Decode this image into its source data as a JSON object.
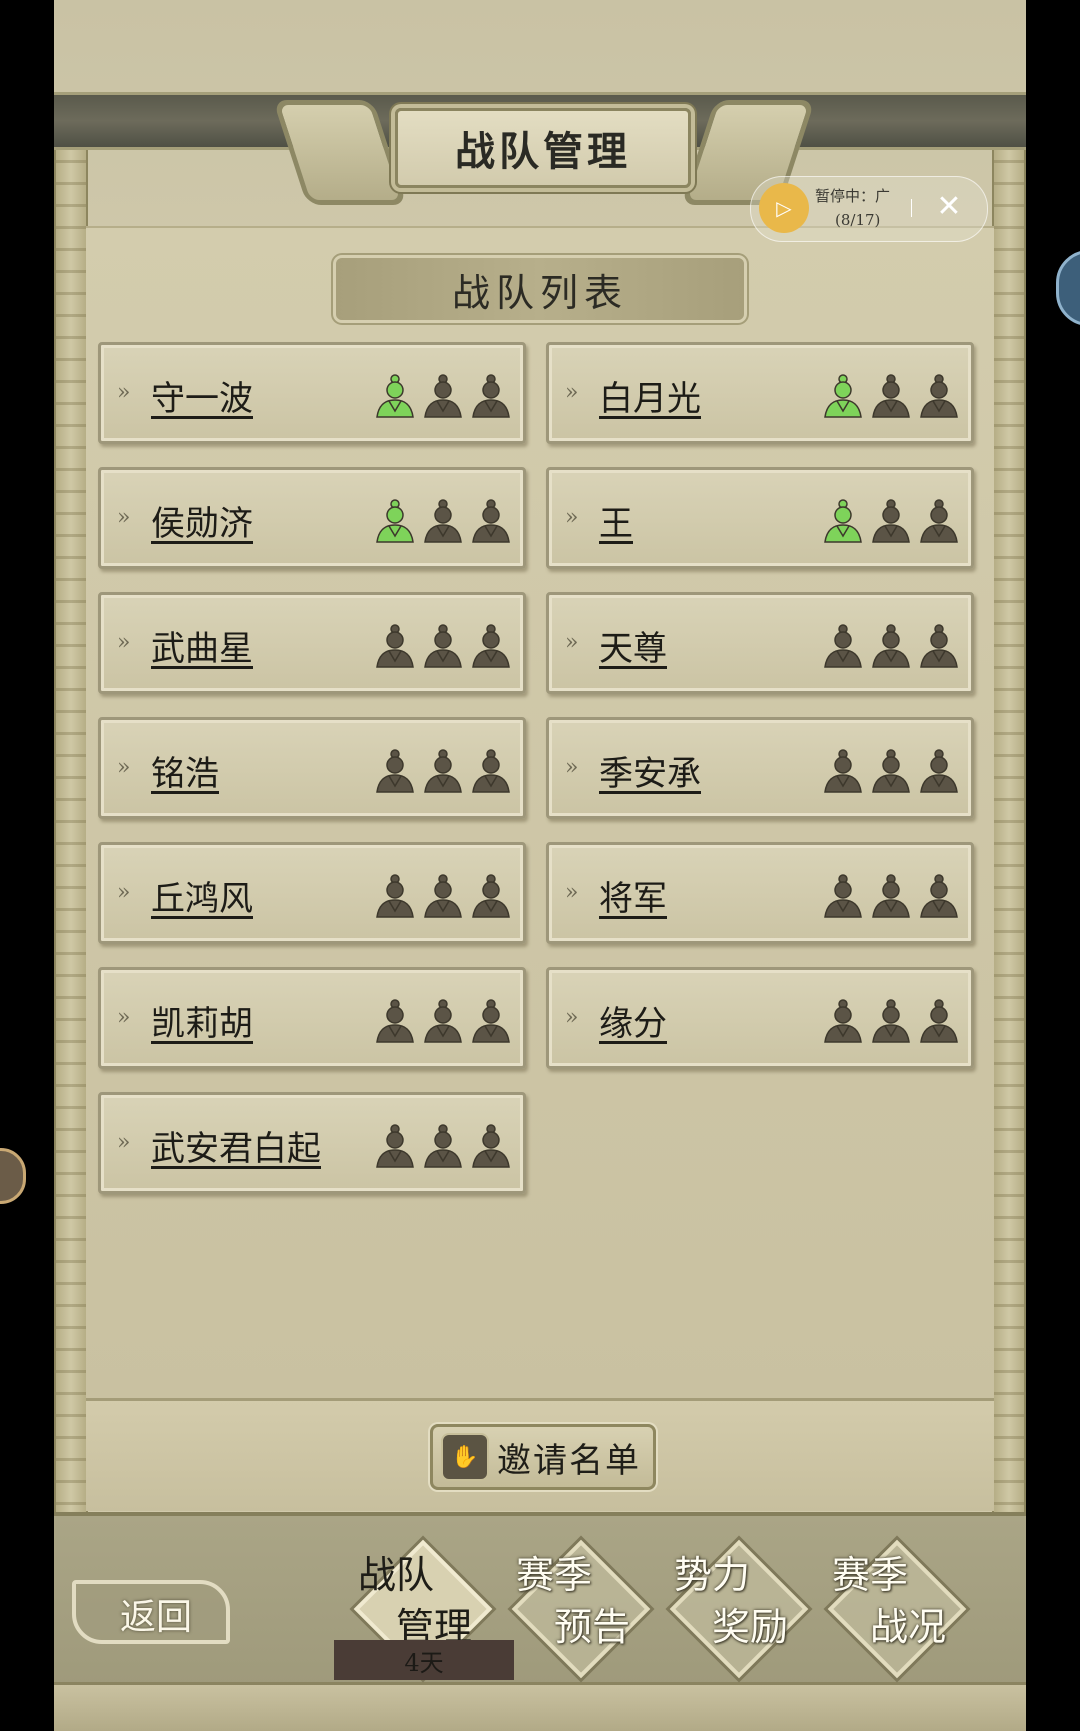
{
  "header": {
    "title": "战队管理"
  },
  "team_list": {
    "title": "战队列表",
    "teams": [
      {
        "name": "守一波",
        "members_filled": 1,
        "slots": 3
      },
      {
        "name": "白月光",
        "members_filled": 1,
        "slots": 3
      },
      {
        "name": "侯勋济",
        "members_filled": 1,
        "slots": 3
      },
      {
        "name": "王",
        "members_filled": 1,
        "slots": 3
      },
      {
        "name": "武曲星",
        "members_filled": 0,
        "slots": 3
      },
      {
        "name": "天尊",
        "members_filled": 0,
        "slots": 3
      },
      {
        "name": "铭浩",
        "members_filled": 0,
        "slots": 3
      },
      {
        "name": "季安承",
        "members_filled": 0,
        "slots": 3
      },
      {
        "name": "丘鸿风",
        "members_filled": 0,
        "slots": 3
      },
      {
        "name": "将军",
        "members_filled": 0,
        "slots": 3
      },
      {
        "name": "凯莉胡",
        "members_filled": 0,
        "slots": 3
      },
      {
        "name": "缘分",
        "members_filled": 0,
        "slots": 3
      },
      {
        "name": "武安君白起",
        "members_filled": 0,
        "slots": 3
      }
    ]
  },
  "invite": {
    "label": "邀请名单",
    "icon": "handshake-icon"
  },
  "bottom_nav": {
    "back_label": "返回",
    "tabs": [
      {
        "line1": "战队",
        "line2": "管理",
        "active": true
      },
      {
        "line1": "赛季",
        "line2": "预告",
        "active": false
      },
      {
        "line1": "势力",
        "line2": "奖励",
        "active": false
      },
      {
        "line1": "赛季",
        "line2": "战况",
        "active": false
      }
    ],
    "timer": "4天"
  },
  "overlay": {
    "status": "暂停中：广",
    "count": "(8/17)",
    "play_icon": "play-icon",
    "close_icon": "close-icon"
  },
  "colors": {
    "member_filled": "#7ed35a",
    "member_empty": "#5b5446",
    "parchment": "#d8d2b5"
  }
}
